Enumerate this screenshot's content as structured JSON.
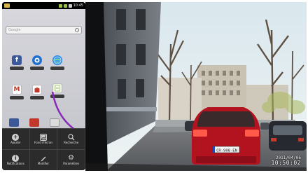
{
  "phone": {
    "status_time": "10:45",
    "search_placeholder": "Google",
    "apps": [
      {
        "name": "facebook",
        "glyph": "f",
        "color": "#3b5998"
      },
      {
        "name": "maps",
        "glyph": "",
        "color": "#1f6fd1"
      },
      {
        "name": "browser",
        "glyph": "",
        "color": "#2b8ee6"
      },
      {
        "name": "gmail",
        "glyph": "M",
        "color": "#ffffff"
      },
      {
        "name": "market",
        "glyph": "",
        "color": "#c0392b"
      },
      {
        "name": "notes",
        "glyph": "",
        "color": "#7fb23a"
      }
    ],
    "menu": {
      "items": [
        {
          "label": "Ajouter",
          "icon": "plus-icon",
          "glyph": "+"
        },
        {
          "label": "Fond d'écran",
          "icon": "wallpaper-icon",
          "glyph": ""
        },
        {
          "label": "Recherche",
          "icon": "search-icon",
          "glyph": ""
        },
        {
          "label": "Notifications",
          "icon": "notifications-icon",
          "glyph": "i"
        },
        {
          "label": "Modifier",
          "icon": "edit-icon",
          "glyph": ""
        },
        {
          "label": "Paramètres",
          "icon": "settings-icon",
          "glyph": "⚙"
        }
      ]
    }
  },
  "dashcam": {
    "date": "2011/04/06",
    "time": "10:50:02",
    "plate": "CR-908-EN"
  },
  "colors": {
    "sky": "#cfe1ea",
    "car_red": "#b3121f",
    "road": "#6d6f72"
  }
}
